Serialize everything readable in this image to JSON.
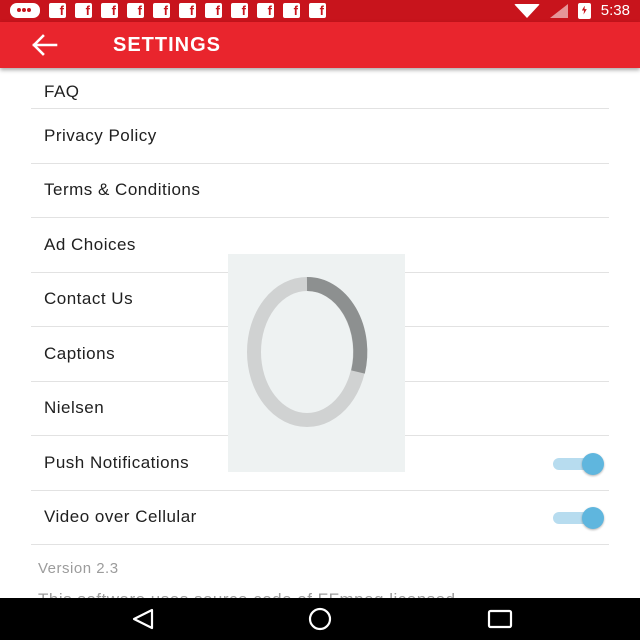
{
  "status_bar": {
    "time": "5:38",
    "icons": [
      "message-icon",
      "facebook-icon",
      "facebook-icon",
      "facebook-icon",
      "facebook-icon",
      "facebook-icon",
      "facebook-icon",
      "facebook-icon",
      "facebook-icon",
      "facebook-icon",
      "facebook-icon",
      "facebook-icon",
      "wifi-icon",
      "cell-signal-icon",
      "battery-charging-icon"
    ],
    "fb_glyph": "f",
    "background": "#c8141c"
  },
  "app_bar": {
    "back_icon": "arrow-left-icon",
    "title": "SETTINGS",
    "background": "#e9252d"
  },
  "settings": {
    "items": [
      {
        "label": "FAQ"
      },
      {
        "label": "Privacy Policy"
      },
      {
        "label": "Terms & Conditions"
      },
      {
        "label": "Ad Choices"
      },
      {
        "label": "Contact Us"
      },
      {
        "label": "Captions"
      },
      {
        "label": "Nielsen"
      },
      {
        "label": "Push Notifications",
        "toggle_on": true
      },
      {
        "label": "Video over Cellular",
        "toggle_on": true
      }
    ],
    "version": "Version 2.3",
    "license_text": "This software uses source code of FFmpeg licensed"
  },
  "loading": {
    "icon": "loading-spinner-icon"
  },
  "nav_bar": {
    "back": "back-triangle-icon",
    "home": "home-circle-icon",
    "recents": "recents-square-icon"
  },
  "colors": {
    "toggle_track": "#b7dcef",
    "toggle_thumb": "#5fb6de"
  }
}
